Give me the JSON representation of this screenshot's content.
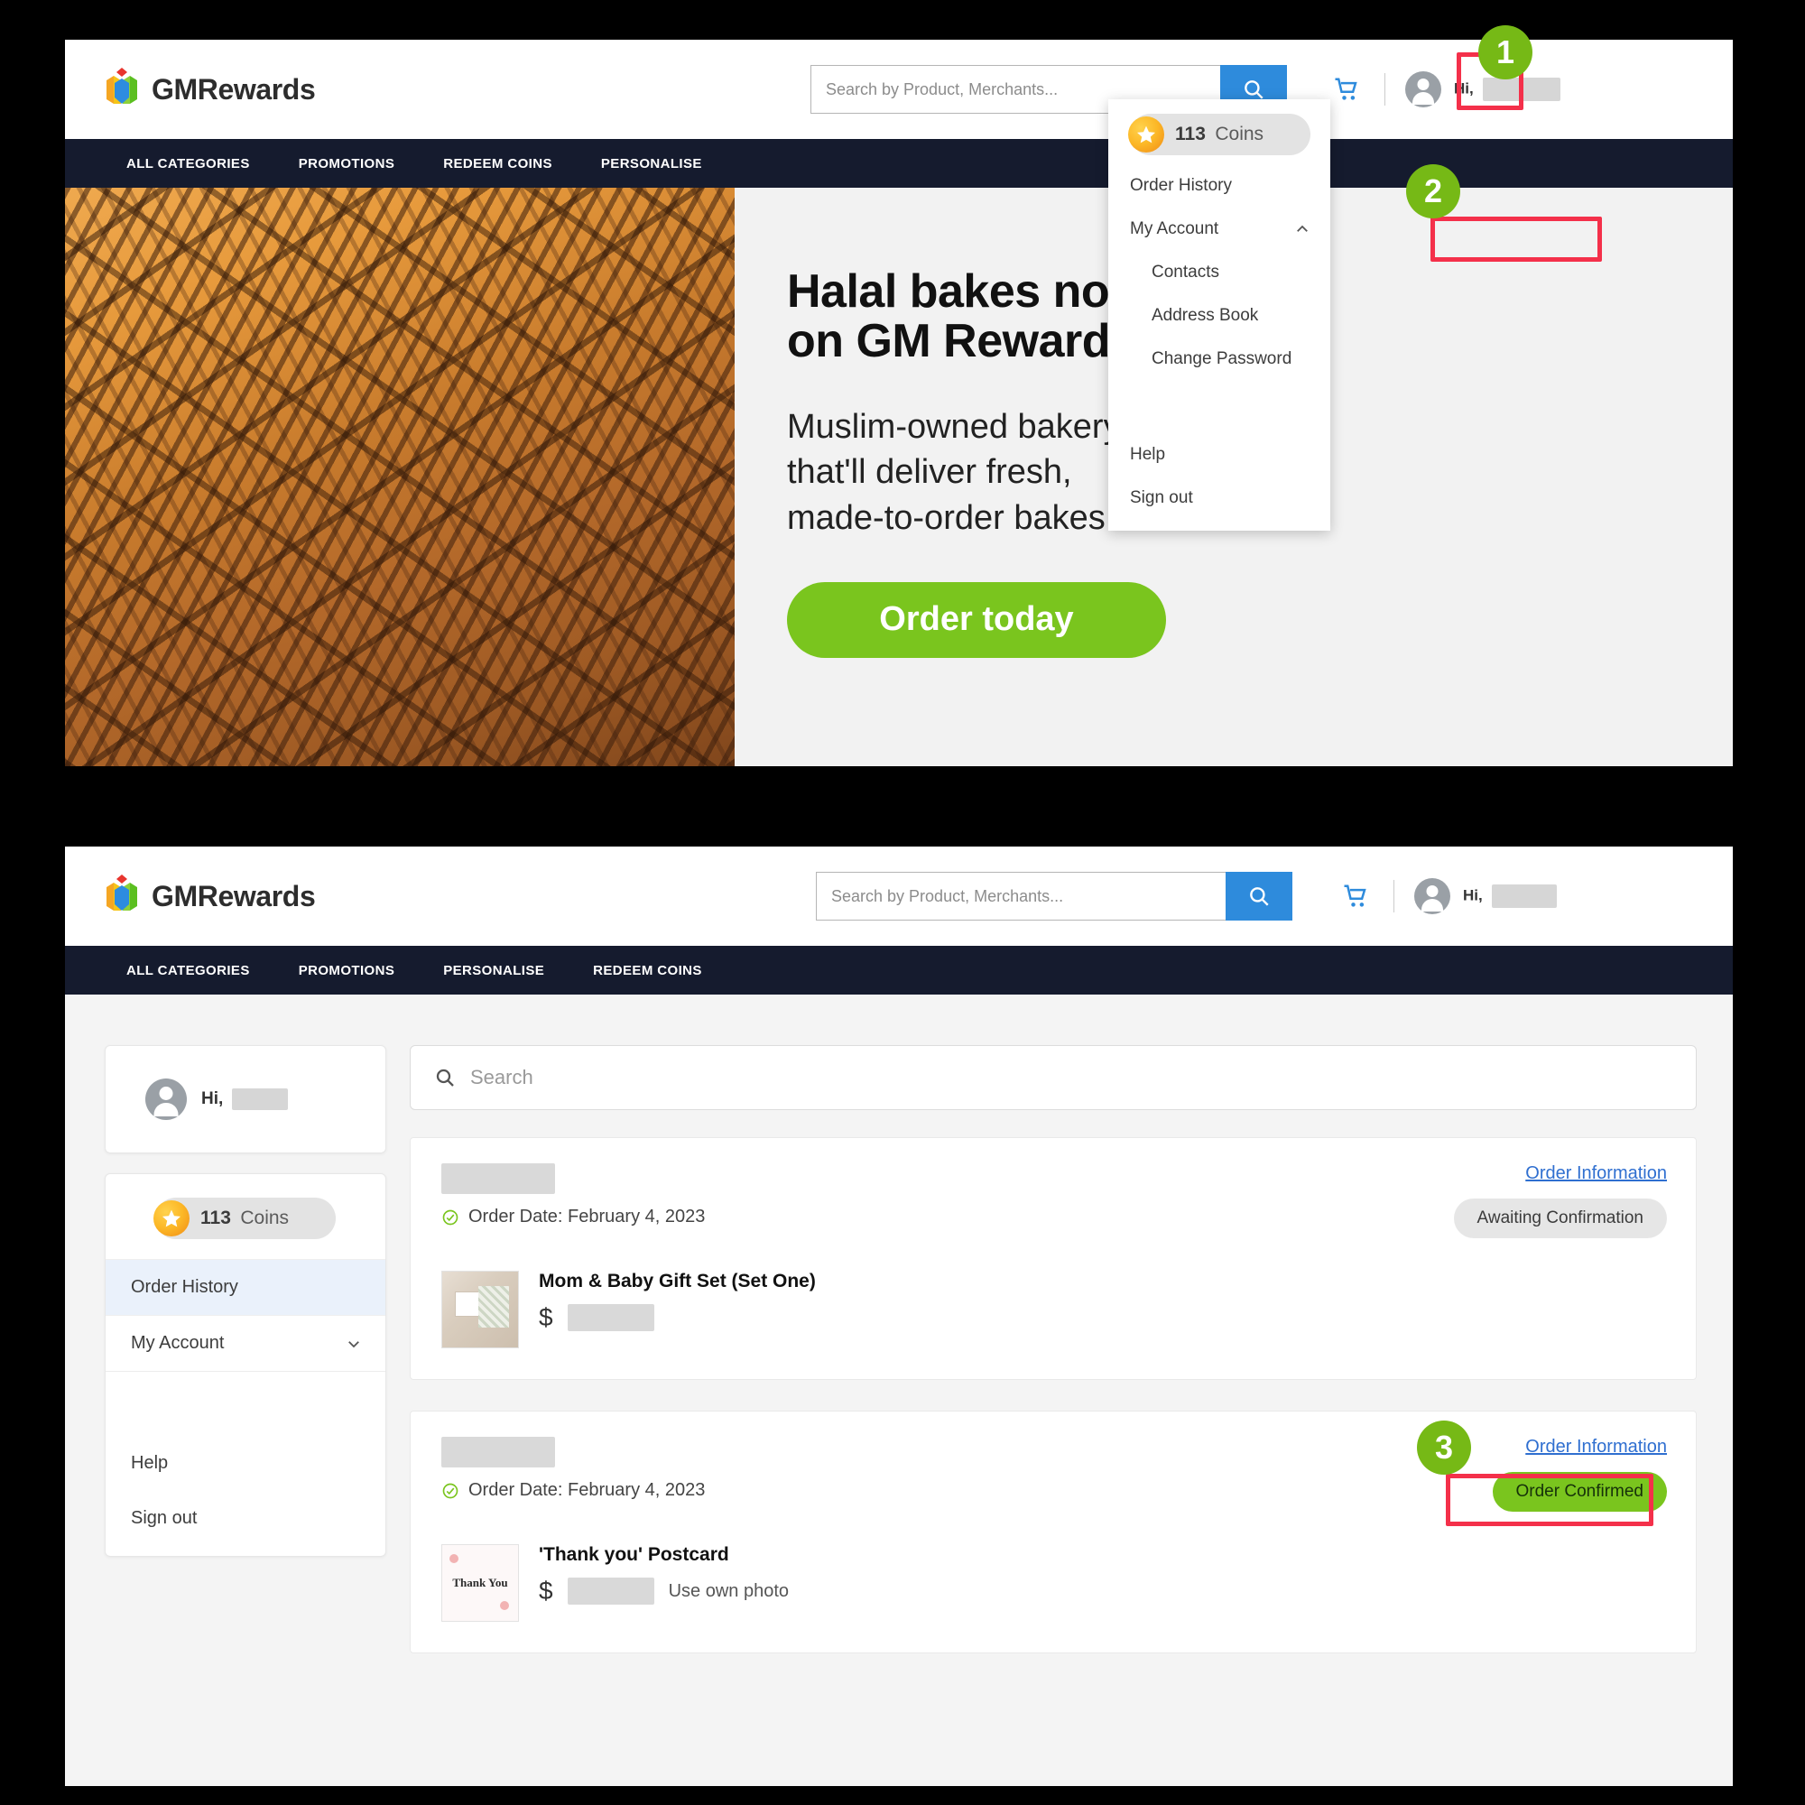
{
  "brand": {
    "name": "GMRewards",
    "logo_icon": "gm-rewards-logo-icon"
  },
  "top_panel": {
    "search": {
      "placeholder": "Search by Product, Merchants...",
      "value": "",
      "icon": "search-icon"
    },
    "cart_icon": "shopping-cart-icon",
    "account_icon": "user-avatar-icon",
    "greeting": "Hi,",
    "nav": [
      {
        "label": "ALL CATEGORIES"
      },
      {
        "label": "PROMOTIONS"
      },
      {
        "label": "REDEEM COINS"
      },
      {
        "label": "PERSONALISE"
      }
    ],
    "banner": {
      "headline_line1": "Halal bakes now",
      "headline_line2": "on GM Rewards",
      "body_line1": "Muslim-owned bakery",
      "body_line2": "that'll deliver fresh,",
      "body_line3": "made-to-order bakes.",
      "cta_label": "Order today",
      "image_alt": "layer-cake-photo"
    },
    "dropdown": {
      "coins_count": "113",
      "coins_word": "Coins",
      "coin_icon": "star-coin-icon",
      "items": [
        {
          "label": "Order History",
          "type": "link"
        },
        {
          "label": "My Account",
          "type": "expander",
          "icon": "chevron-up-icon"
        },
        {
          "label": "Contacts",
          "type": "sub"
        },
        {
          "label": "Address Book",
          "type": "sub"
        },
        {
          "label": "Change Password",
          "type": "sub"
        },
        {
          "label": "Help",
          "type": "link"
        },
        {
          "label": "Sign out",
          "type": "link"
        }
      ]
    }
  },
  "bottom_panel": {
    "search": {
      "placeholder": "Search by Product, Merchants...",
      "value": "",
      "icon": "search-icon"
    },
    "cart_icon": "shopping-cart-icon",
    "account_icon": "user-avatar-icon",
    "greeting": "Hi,",
    "nav": [
      {
        "label": "ALL CATEGORIES"
      },
      {
        "label": "PROMOTIONS"
      },
      {
        "label": "PERSONALISE"
      },
      {
        "label": "REDEEM COINS"
      }
    ],
    "sidebar": {
      "greeting": "Hi,",
      "coins_count": "113",
      "coins_word": "Coins",
      "coin_icon": "star-coin-icon",
      "items": [
        {
          "label": "Order History",
          "active": true
        },
        {
          "label": "My Account",
          "active": false,
          "icon": "chevron-down-icon"
        },
        {
          "label": "Help",
          "active": false
        },
        {
          "label": "Sign out",
          "active": false
        }
      ]
    },
    "order_search": {
      "placeholder": "Search",
      "value": "",
      "icon": "search-icon"
    },
    "orders": [
      {
        "merchant": "",
        "date_label": "Order Date: February 4, 2023",
        "date_icon": "check-circle-icon",
        "info_link": "Order Information",
        "status": "Awaiting Confirmation",
        "status_kind": "awaiting",
        "product_name": "Mom & Baby Gift Set (Set One)",
        "currency": "$",
        "price": "",
        "note": "",
        "thumb": "gift-set-thumbnail"
      },
      {
        "merchant": "",
        "date_label": "Order Date: February 4, 2023",
        "date_icon": "check-circle-icon",
        "info_link": "Order Information",
        "status": "Order Confirmed",
        "status_kind": "confirmed",
        "product_name": "'Thank you' Postcard",
        "currency": "$",
        "price": "",
        "note": "Use own photo",
        "thumb": "thank-you-postcard-thumbnail",
        "thumb_text": "Thank You"
      }
    ]
  },
  "annotations": {
    "steps": [
      {
        "number": "1"
      },
      {
        "number": "2"
      },
      {
        "number": "3"
      }
    ],
    "highlight_color": "#f4304a",
    "badge_color": "#76b916"
  }
}
